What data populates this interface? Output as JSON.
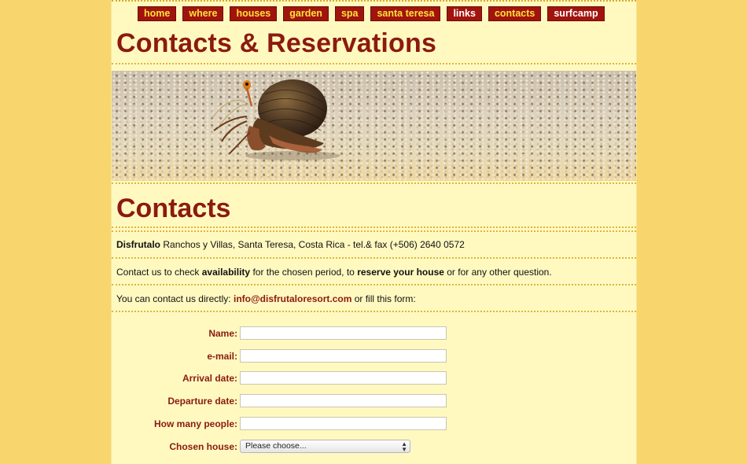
{
  "nav": {
    "items": [
      {
        "label": "home"
      },
      {
        "label": "where"
      },
      {
        "label": "houses"
      },
      {
        "label": "garden"
      },
      {
        "label": "spa"
      },
      {
        "label": "santa teresa"
      },
      {
        "label": "links"
      },
      {
        "label": "contacts"
      },
      {
        "label": "surfcamp"
      }
    ]
  },
  "page_title": "Contacts & Reservations",
  "banner": {
    "subject": "hermit crab on sand"
  },
  "section_title": "Contacts",
  "info": {
    "company": "Disfrutalo",
    "address": "Ranchos y Villas, Santa Teresa, Costa Rica - tel.& fax (+506) 2640 0572"
  },
  "availability": {
    "prefix": "Contact us to check ",
    "bold1": "availability",
    "middle": " for the chosen period, to ",
    "bold2": "reserve your house",
    "suffix": " or for any other question."
  },
  "contact_line": {
    "prefix": "You can contact us directly: ",
    "email": "info@disfrutaloresort.com",
    "suffix": " or fill this form:"
  },
  "form": {
    "fields": [
      {
        "label": "Name:",
        "value": ""
      },
      {
        "label": "e-mail:",
        "value": ""
      },
      {
        "label": "Arrival date:",
        "value": ""
      },
      {
        "label": "Departure date:",
        "value": ""
      },
      {
        "label": "How many people:",
        "value": ""
      }
    ],
    "chosen_house": {
      "label": "Chosen house:",
      "selected": "Please choose..."
    }
  },
  "colors": {
    "background": "#f9d56e",
    "page": "#fff9c0",
    "accent": "#8c1a10",
    "nav_bg": "#a1140e",
    "nav_text": "#ffe23a"
  }
}
